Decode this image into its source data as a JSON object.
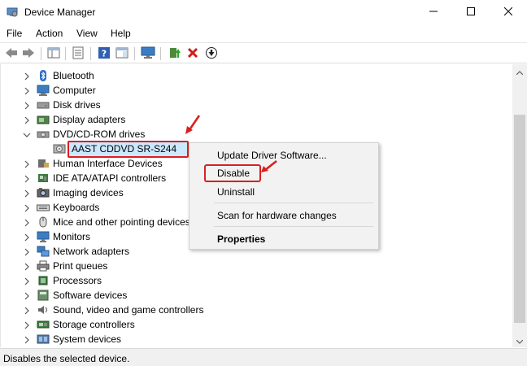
{
  "window": {
    "title": "Device Manager",
    "controls": [
      "minimize-icon",
      "maximize-icon",
      "close-icon"
    ]
  },
  "menu": [
    "File",
    "Action",
    "View",
    "Help"
  ],
  "toolbar": {
    "buttons": [
      "back-arrow-icon",
      "forward-arrow-icon",
      "show-hide-console-tree-icon",
      "properties-icon",
      "help-icon",
      "action-pane-icon",
      "monitor-icon",
      "update-driver-icon",
      "uninstall-x-icon",
      "disable-device-icon"
    ]
  },
  "tree": {
    "items": [
      {
        "label": "Bluetooth",
        "icon": "bluetooth-icon",
        "expanded": false
      },
      {
        "label": "Computer",
        "icon": "computer-icon",
        "expanded": false
      },
      {
        "label": "Disk drives",
        "icon": "disk-drive-icon",
        "expanded": false
      },
      {
        "label": "Display adapters",
        "icon": "display-adapter-icon",
        "expanded": false
      },
      {
        "label": "DVD/CD-ROM drives",
        "icon": "dvd-drive-icon",
        "expanded": true
      },
      {
        "label": "AAST CDDVD SR-S244",
        "icon": "dvd-device-icon",
        "child": true,
        "selected": true
      },
      {
        "label": "Human Interface Devices",
        "icon": "hid-icon",
        "expanded": false
      },
      {
        "label": "IDE ATA/ATAPI controllers",
        "icon": "ide-controller-icon",
        "expanded": false
      },
      {
        "label": "Imaging devices",
        "icon": "imaging-device-icon",
        "expanded": false
      },
      {
        "label": "Keyboards",
        "icon": "keyboard-icon",
        "expanded": false
      },
      {
        "label": "Mice and other pointing devices",
        "icon": "mouse-icon",
        "expanded": false
      },
      {
        "label": "Monitors",
        "icon": "monitor-icon",
        "expanded": false
      },
      {
        "label": "Network adapters",
        "icon": "network-adapter-icon",
        "expanded": false
      },
      {
        "label": "Print queues",
        "icon": "printer-icon",
        "expanded": false
      },
      {
        "label": "Processors",
        "icon": "processor-icon",
        "expanded": false
      },
      {
        "label": "Software devices",
        "icon": "software-device-icon",
        "expanded": false
      },
      {
        "label": "Sound, video and game controllers",
        "icon": "speaker-icon",
        "expanded": false
      },
      {
        "label": "Storage controllers",
        "icon": "storage-controller-icon",
        "expanded": false
      },
      {
        "label": "System devices",
        "icon": "system-device-icon",
        "expanded": false
      }
    ]
  },
  "context_menu": {
    "items": [
      "Update Driver Software...",
      "Disable",
      "Uninstall",
      "Scan for hardware changes",
      "Properties"
    ]
  },
  "status": {
    "text": "Disables the selected device."
  },
  "colors": {
    "selection": "#cce8ff",
    "highlight_red": "#d82020"
  }
}
